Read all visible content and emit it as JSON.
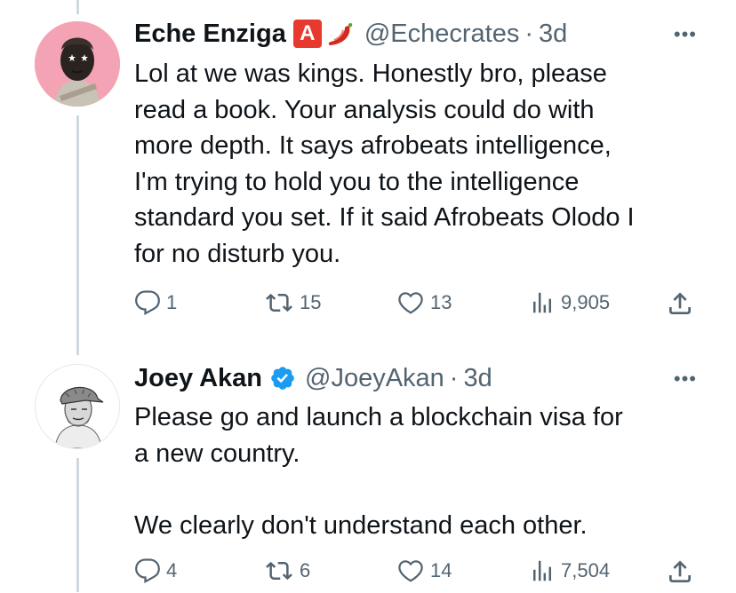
{
  "colors": {
    "accent": "#1d9bf0",
    "muted": "#536471",
    "text": "#0f1419",
    "line": "#cfd9de"
  },
  "tweets": [
    {
      "name": "Eche Enziga",
      "emoji_badge": "🅰",
      "emoji_pepper": "🌶",
      "handle": "@Echecrates",
      "separator": "·",
      "time": "3d",
      "more": "•••",
      "text": "Lol at we was kings. Honestly bro, please\nread a book. Your analysis could do with\nmore depth. It says afrobeats intelligence,\nI'm trying to hold you to the intelligence\nstandard you set. If it said Afrobeats Olodo I\nfor no disturb you.",
      "replies": "1",
      "retweets": "15",
      "likes": "13",
      "views": "9,905",
      "icons": [
        "reply-icon",
        "retweet-icon",
        "like-icon",
        "views-icon",
        "share-icon"
      ]
    },
    {
      "name": "Joey Akan",
      "verified": true,
      "handle": "@JoeyAkan",
      "separator": "·",
      "time": "3d",
      "more": "•••",
      "text": "Please go and launch a blockchain visa for\na new country.\n\nWe clearly don't understand each other.",
      "replies": "4",
      "retweets": "6",
      "likes": "14",
      "views": "7,504",
      "icons": [
        "reply-icon",
        "retweet-icon",
        "like-icon",
        "views-icon",
        "share-icon"
      ]
    }
  ]
}
